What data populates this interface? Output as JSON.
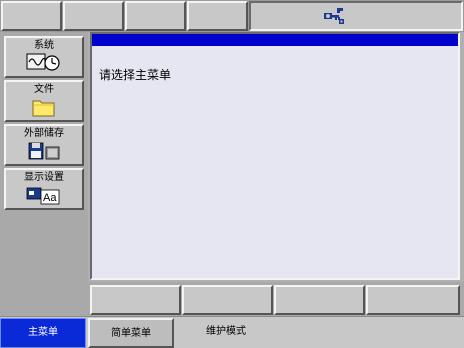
{
  "top_bar": {
    "status_icon": "key-icon",
    "icon_color": "#1a3a8f"
  },
  "left_menu": {
    "items": [
      {
        "label": "系统",
        "icon": "waveform-clock-icon"
      },
      {
        "label": "文件",
        "icon": "folder-icon"
      },
      {
        "label": "外部储存",
        "icon": "floppy-disk-icon"
      },
      {
        "label": "显示设置",
        "icon": "display-font-icon"
      }
    ]
  },
  "main": {
    "message": "请选择主菜单",
    "title_color": "#0000cc"
  },
  "bottom_tabs": {
    "main_menu": "主菜单",
    "simple_menu": "简单菜单",
    "maintenance_mode": "维护模式",
    "active_color": "#0a2ad8"
  }
}
